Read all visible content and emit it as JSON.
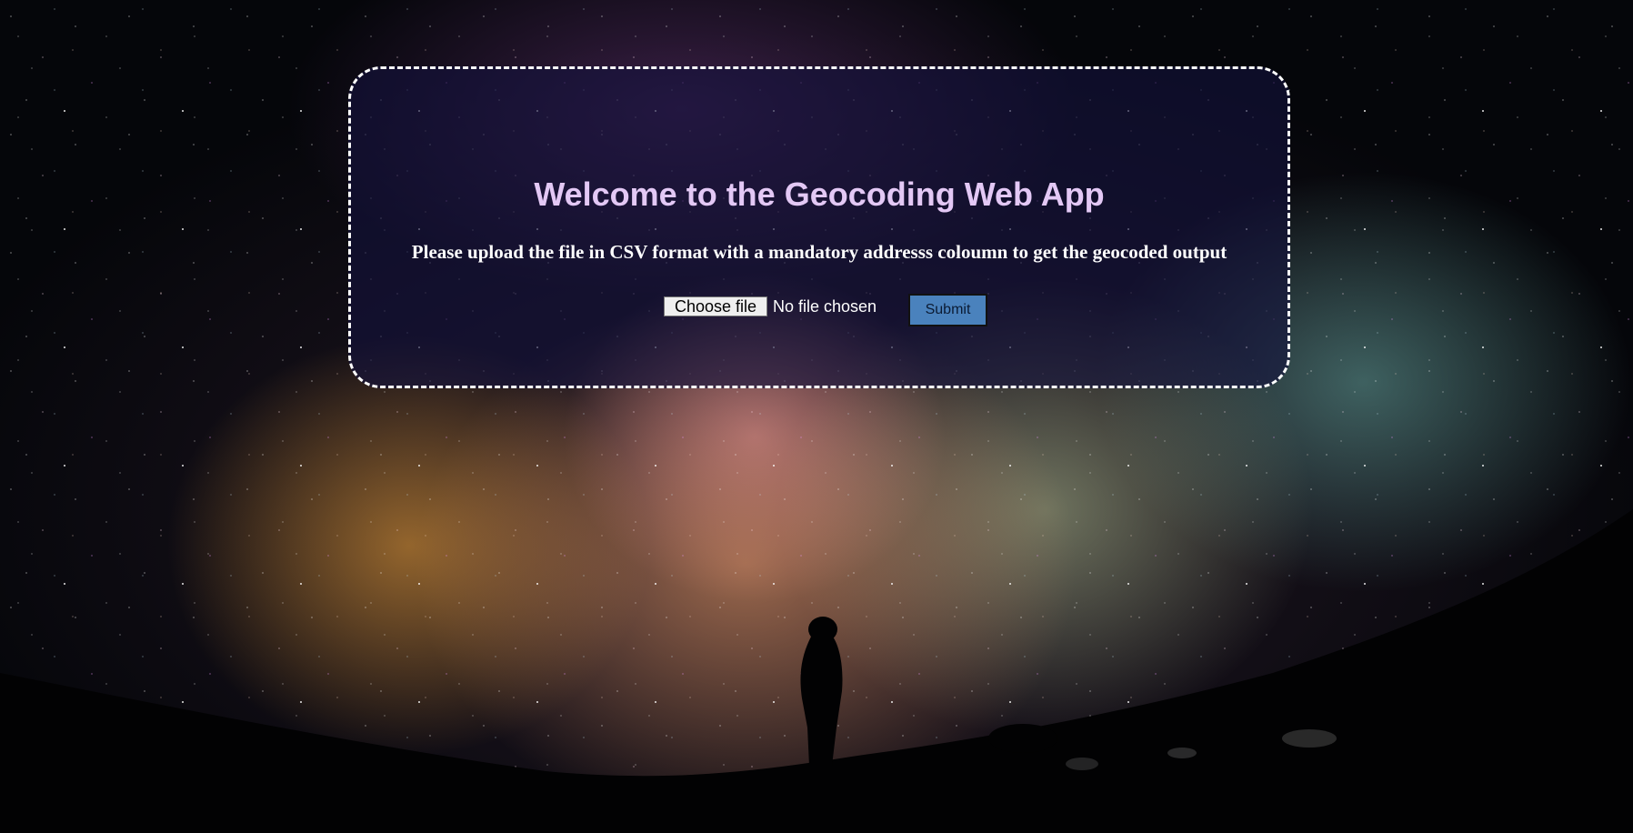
{
  "page": {
    "heading": "Welcome to the Geocoding Web App",
    "instructions": "Please upload the file in CSV format with a mandatory addresss coloumn to get the geocoded output"
  },
  "upload_form": {
    "choose_file_label": "Choose file",
    "file_status": "No file chosen",
    "submit_label": "Submit"
  },
  "colors": {
    "heading": "#e3c8f5",
    "card_background": "rgba(20, 18, 60, 0.62)",
    "card_border": "#ffffff",
    "submit_button": "#4a82bd"
  }
}
